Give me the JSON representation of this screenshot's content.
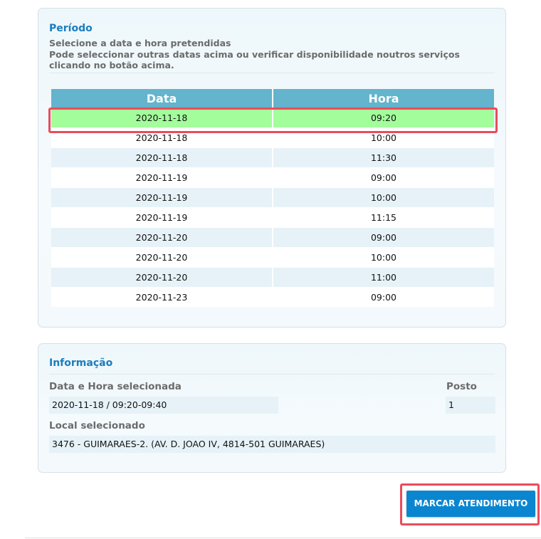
{
  "periodo": {
    "title": "Período",
    "line1": "Selecione a data e hora pretendidas",
    "line2": "Pode seleccionar outras datas acima ou verificar disponibilidade noutros serviços clicando no botão acima.",
    "headers": {
      "data": "Data",
      "hora": "Hora"
    },
    "rows": [
      {
        "data": "2020-11-18",
        "hora": "09:20"
      },
      {
        "data": "2020-11-18",
        "hora": "10:00"
      },
      {
        "data": "2020-11-18",
        "hora": "11:30"
      },
      {
        "data": "2020-11-19",
        "hora": "09:00"
      },
      {
        "data": "2020-11-19",
        "hora": "10:00"
      },
      {
        "data": "2020-11-19",
        "hora": "11:15"
      },
      {
        "data": "2020-11-20",
        "hora": "09:00"
      },
      {
        "data": "2020-11-20",
        "hora": "10:00"
      },
      {
        "data": "2020-11-20",
        "hora": "11:00"
      },
      {
        "data": "2020-11-23",
        "hora": "09:00"
      }
    ],
    "selected_index": 0
  },
  "informacao": {
    "title": "Informação",
    "data_hora_label": "Data e Hora selecionada",
    "data_hora_value": "2020-11-18 / 09:20-09:40",
    "posto_label": "Posto",
    "posto_value": "1",
    "local_label": "Local selecionado",
    "local_value": "3476 - GUIMARAES-2. (AV. D. JOAO IV, 4814-501 GUIMARAES)"
  },
  "action": {
    "marcar_label": "MARCAR ATENDIMENTO"
  },
  "colors": {
    "accent": "#1a7dbf",
    "header": "#63b4cc",
    "selected_row": "#a3fd9b",
    "highlight": "#e84c5c",
    "button": "#0a86d1"
  }
}
